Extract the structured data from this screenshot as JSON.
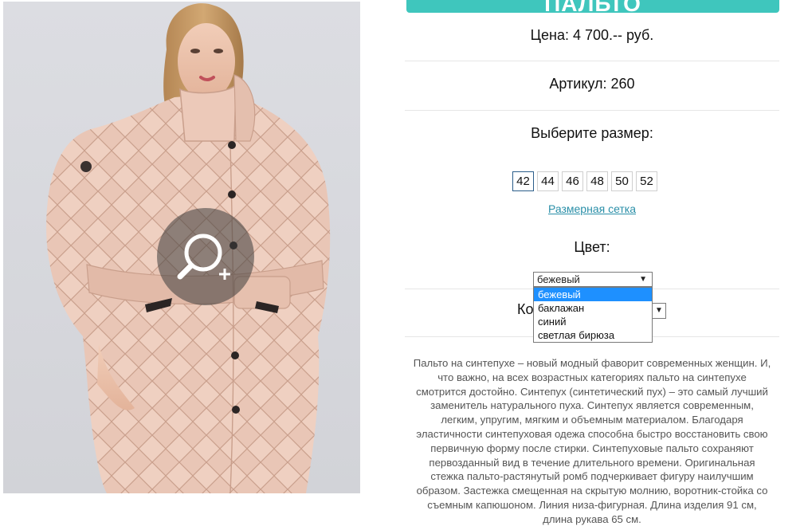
{
  "product": {
    "title": "ПАЛЬТО",
    "price": "Цена: 4 700.-- руб.",
    "article": "Артикул: 260",
    "size_prompt": "Выберите размер:",
    "sizes": [
      "42",
      "44",
      "46",
      "48",
      "50",
      "52"
    ],
    "selected_size": "42",
    "size_chart_link": "Размерная сетка",
    "color_label": "Цвет:",
    "color_selected": "бежевый",
    "color_options": [
      "бежевый",
      "баклажан",
      "синий",
      "светлая бирюза"
    ],
    "quantity_label_partial": "Ко",
    "description": "Пальто на синтепухе – новый модный фаворит современных женщин. И, что важно, на всех возрастных категориях пальто на синтепухе смотрится достойно. Синтепух (синтетический пух) – это самый лучший заменитель натурального пуха. Синтепух является современным, легким, упругим, мягким и объемным материалом. Благодаря эластичности синтепуховая одежа способна быстро восстановить свою первичную форму после стирки. Синтепуховые пальто сохраняют первозданный вид в течение длительного времени. Оригинальная стежка пальто-растянутый ромб подчеркивает фигуру наилучшим образом. Застежка смещенная на скрытую молнию, воротник-стойка со съемным капюшоном. Линия низа-фигурная. Длина изделия 91 см, длина рукава 65 см."
  },
  "icons": {
    "zoom": "zoom-in-icon",
    "dropdown_arrow": "chevron-down-icon"
  },
  "colors": {
    "accent": "#3fc6bd",
    "link": "#2a8fa8",
    "dropdown_highlight": "#1e90ff",
    "coat": "#e8c4b4"
  }
}
